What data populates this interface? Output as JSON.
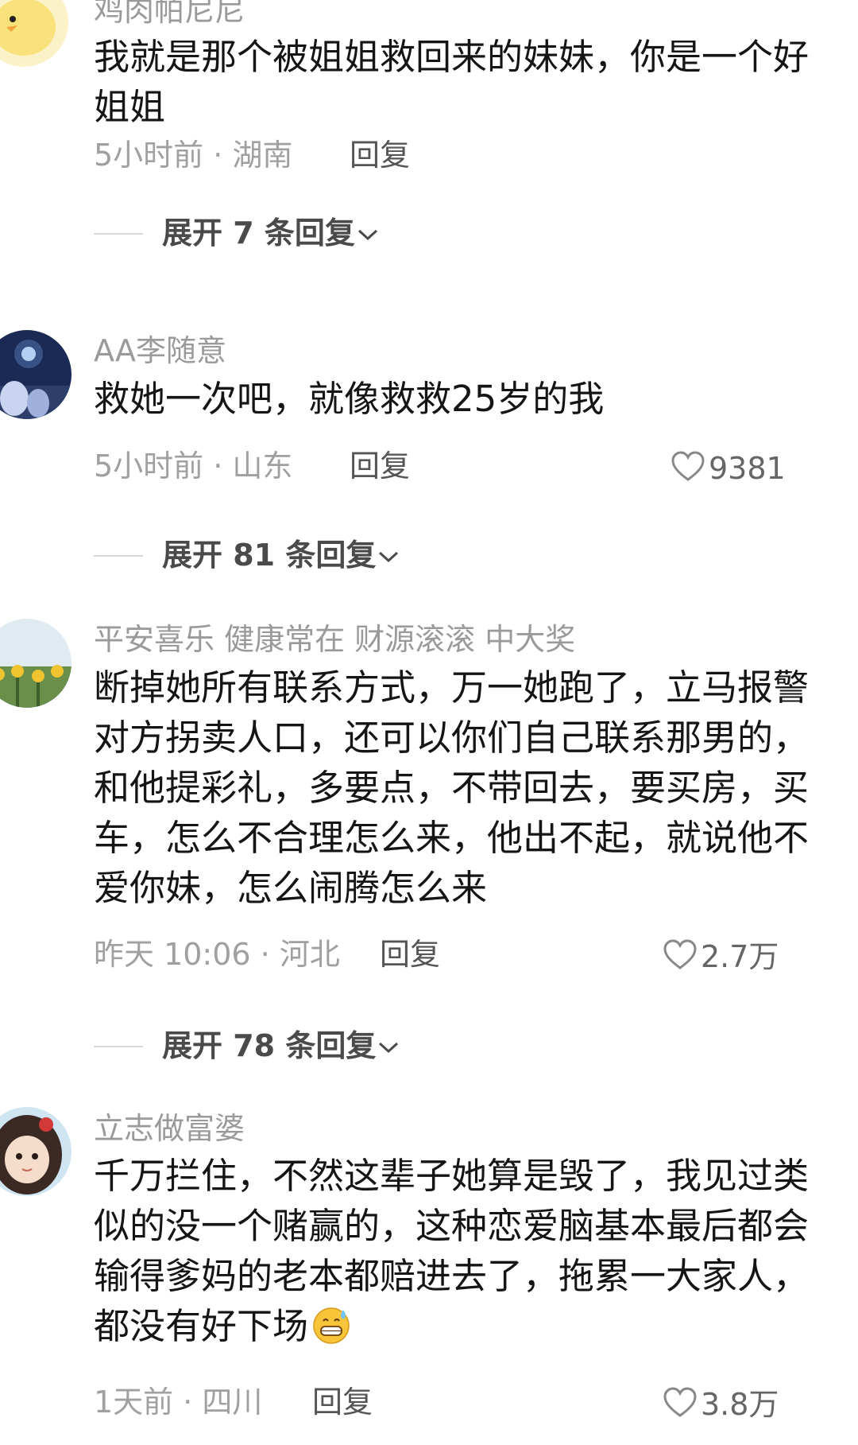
{
  "comments": [
    {
      "username": "鸡肉帕尼尼",
      "lines": [
        "我就是那个被姐姐救回来的妹妹，你是一个好",
        "姐姐"
      ],
      "time_location": "5小时前 · 湖南",
      "reply_label": "回复",
      "likes": "",
      "expand_label": "展开 7 条回复"
    },
    {
      "username": "AA李随意",
      "lines": [
        "救她一次吧，就像救救25岁的我"
      ],
      "time_location": "5小时前 · 山东",
      "reply_label": "回复",
      "likes": "9381",
      "expand_label": "展开 81 条回复"
    },
    {
      "username": "平安喜乐 健康常在 财源滚滚 中大奖",
      "lines": [
        "断掉她所有联系方式，万一她跑了，立马报警",
        "对方拐卖人口，还可以你们自己联系那男的，",
        "和他提彩礼，多要点，不带回去，要买房，买",
        "车，怎么不合理怎么来，他出不起，就说他不",
        "爱你妹，怎么闹腾怎么来"
      ],
      "time_location": "昨天 10:06 · 河北",
      "reply_label": "回复",
      "likes": "2.7万",
      "expand_label": "展开 78 条回复"
    },
    {
      "username": "立志做富婆",
      "lines": [
        "千万拦住，不然这辈子她算是毁了，我见过类",
        "似的没一个赌赢的，这种恋爱脑基本最后都会",
        "输得爹妈的老本都赔进去了，拖累一大家人，",
        "都没有好下场"
      ],
      "time_location": "1天前 · 四川",
      "reply_label": "回复",
      "likes": "3.8万",
      "emoji": "grinning-sweat-emoji"
    }
  ],
  "icons": {
    "heart": "heart-outline-icon",
    "chevron": "chevron-down-icon"
  },
  "colors": {
    "text_primary": "#151515",
    "text_secondary": "#9a9a9a",
    "reply": "#555555",
    "divider": "#d8d8d8"
  }
}
